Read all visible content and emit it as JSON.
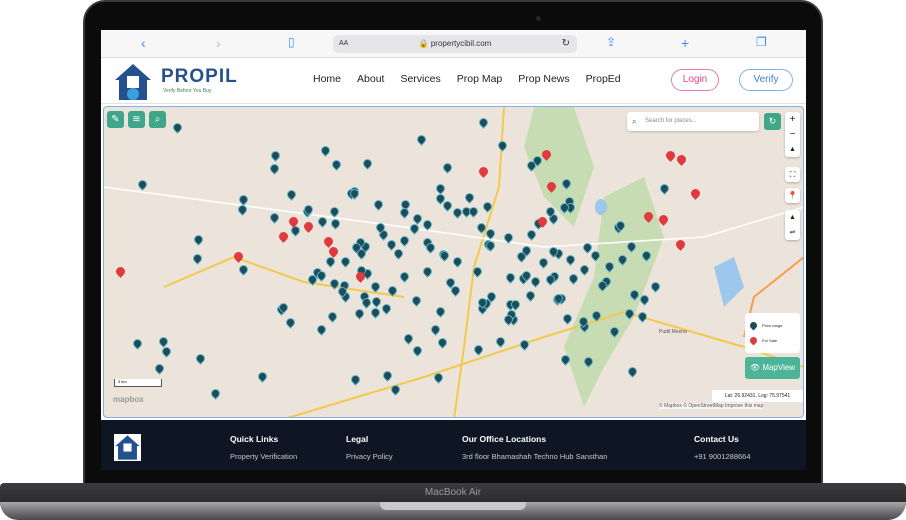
{
  "device": {
    "label": "MacBook Air"
  },
  "browser": {
    "url": "propertycibil.com",
    "text_size": "AA"
  },
  "header": {
    "brand": "PROPIL",
    "tagline": "Verify Before You Buy",
    "menu": [
      "Home",
      "About",
      "Services",
      "Prop Map",
      "Prop News",
      "PropEd"
    ],
    "login": "Login",
    "verify": "Verify"
  },
  "map": {
    "search_placeholder": "Search for places...",
    "legend": [
      {
        "label": "Price range",
        "color": "#1f4b5a"
      },
      {
        "label": "For Sale",
        "color": "#e0393e"
      }
    ],
    "mapview": "MapView",
    "coords": "Lat: 26.92431, Log: 75.97541",
    "scale": "3 km",
    "attribution": "© Mapbox © OpenStreetMap Improve this map",
    "mapbox": "mapbox",
    "place": "Pudil Meena"
  },
  "footer": {
    "headings": [
      "Quick Links",
      "Legal",
      "Our Office Locations",
      "Contact Us"
    ],
    "links": [
      "Property Verification",
      "Privacy Policy",
      "3rd floor Bhamashah Techno Hub Sansthan",
      "+91 9001288664"
    ]
  },
  "colors": {
    "accent": "#3fa68a",
    "marker": "#1f4b5a",
    "sale": "#e0393e"
  }
}
